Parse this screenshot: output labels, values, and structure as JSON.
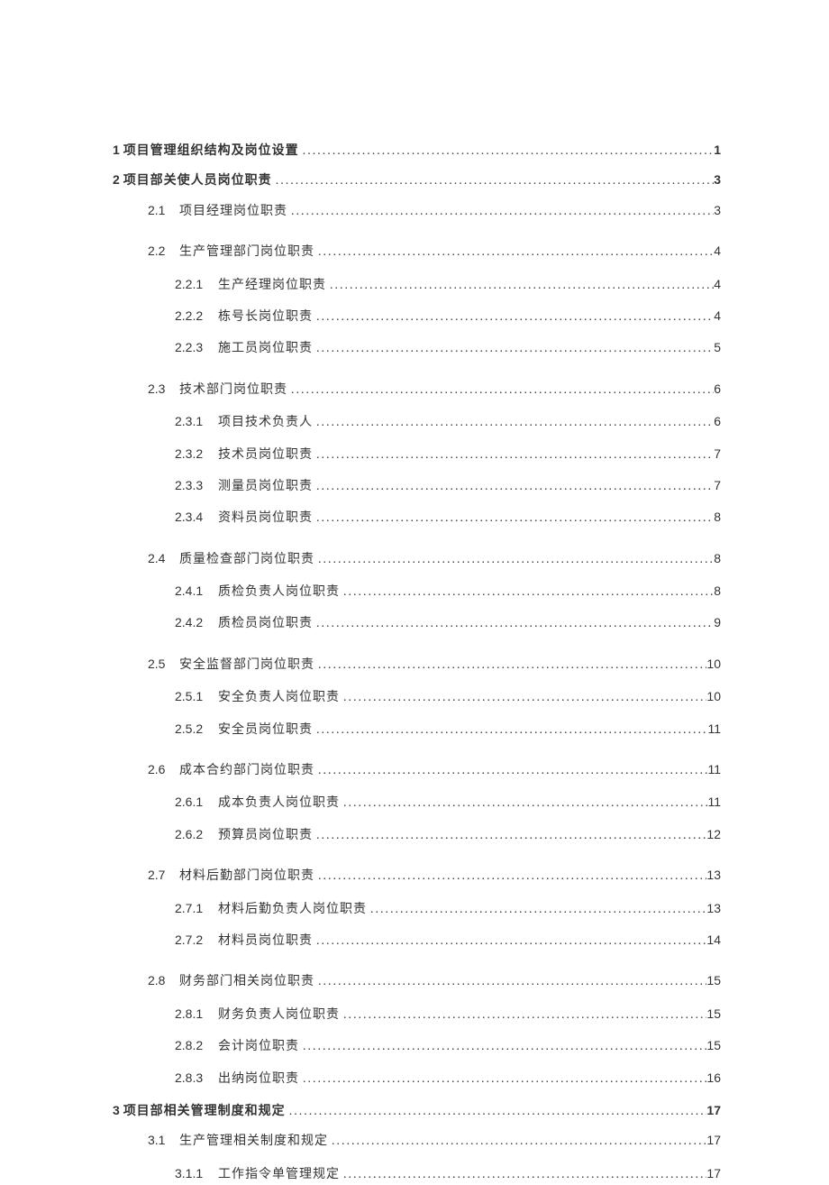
{
  "toc": [
    {
      "lvl": 1,
      "num": "1 ",
      "title": "项目管理组织结构及岗位设置",
      "page": "1",
      "bold": true
    },
    {
      "lvl": 1,
      "num": "2 ",
      "title": "项目部关使人员岗位职责",
      "page": "3",
      "bold": true
    },
    {
      "lvl": 2,
      "num": "2.1",
      "title": "项目经理岗位职责",
      "page": "3",
      "cls": "lvl2-section"
    },
    {
      "lvl": 2,
      "num": "2.2",
      "title": "生产管理部门岗位职责",
      "page": "4",
      "cls": "lvl2-section tight"
    },
    {
      "lvl": 3,
      "num": "2.2.1",
      "title": "生产经理岗位职责",
      "page": "4"
    },
    {
      "lvl": 3,
      "num": "2.2.2",
      "title": "栋号长岗位职责",
      "page": "4"
    },
    {
      "lvl": 3,
      "num": "2.2.3",
      "title": "施工员岗位职责",
      "page": "5",
      "cls": "lvl2-section"
    },
    {
      "lvl": 2,
      "num": "2.3",
      "title": "技术部门岗位职责",
      "page": "6",
      "cls": "lvl2-section tight"
    },
    {
      "lvl": 3,
      "num": "2.3.1",
      "title": "项目技术负责人",
      "page": "6"
    },
    {
      "lvl": 3,
      "num": "2.3.2",
      "title": "技术员岗位职责",
      "page": "7"
    },
    {
      "lvl": 3,
      "num": "2.3.3",
      "title": "测量员岗位职责",
      "page": "7"
    },
    {
      "lvl": 3,
      "num": "2.3.4",
      "title": "资料员岗位职责",
      "page": "8",
      "cls": "lvl2-section"
    },
    {
      "lvl": 2,
      "num": "2.4",
      "title": "质量检查部门岗位职责",
      "page": "8",
      "cls": "lvl2-section tight"
    },
    {
      "lvl": 3,
      "num": "2.4.1",
      "title": "质检负责人岗位职责",
      "page": "8"
    },
    {
      "lvl": 3,
      "num": "2.4.2",
      "title": "质检员岗位职责",
      "page": "9",
      "cls": "lvl2-section"
    },
    {
      "lvl": 2,
      "num": "2.5",
      "title": "安全监督部门岗位职责",
      "page": "10",
      "cls": "lvl2-section tight"
    },
    {
      "lvl": 3,
      "num": "2.5.1",
      "title": "安全负责人岗位职责",
      "page": "10"
    },
    {
      "lvl": 3,
      "num": "2.5.2",
      "title": "安全员岗位职责",
      "page": "11",
      "cls": "lvl2-section"
    },
    {
      "lvl": 2,
      "num": "2.6",
      "title": "成本合约部门岗位职责",
      "page": "11",
      "cls": "lvl2-section tight"
    },
    {
      "lvl": 3,
      "num": "2.6.1",
      "title": "成本负责人岗位职责",
      "page": "11"
    },
    {
      "lvl": 3,
      "num": "2.6.2",
      "title": "预算员岗位职责",
      "page": "12",
      "cls": "lvl2-section"
    },
    {
      "lvl": 2,
      "num": "2.7",
      "title": "材料后勤部门岗位职责",
      "page": "13",
      "cls": "lvl2-section tight"
    },
    {
      "lvl": 3,
      "num": "2.7.1",
      "title": "材料后勤负责人岗位职责",
      "page": "13"
    },
    {
      "lvl": 3,
      "num": "2.7.2",
      "title": "材料员岗位职责",
      "page": "14",
      "cls": "lvl2-section"
    },
    {
      "lvl": 2,
      "num": "2.8",
      "title": "财务部门相关岗位职责",
      "page": "15",
      "cls": "lvl2-section tight"
    },
    {
      "lvl": 3,
      "num": "2.8.1",
      "title": "财务负责人岗位职责",
      "page": "15"
    },
    {
      "lvl": 3,
      "num": "2.8.2",
      "title": "会计岗位职责",
      "page": "15"
    },
    {
      "lvl": 3,
      "num": "2.8.3",
      "title": "出纳岗位职责",
      "page": "16",
      "cls": "lvl2-section tight"
    },
    {
      "lvl": 1,
      "num": "3 ",
      "title": "项目部相关管理制度和规定",
      "page": "17",
      "bold": true
    },
    {
      "lvl": 2,
      "num": "3.1",
      "title": "生产管理相关制度和规定",
      "page": "17",
      "cls": "lvl2-section tight"
    },
    {
      "lvl": 3,
      "num": "3.1.1",
      "title": "工作指令单管理规定",
      "page": "17"
    }
  ]
}
